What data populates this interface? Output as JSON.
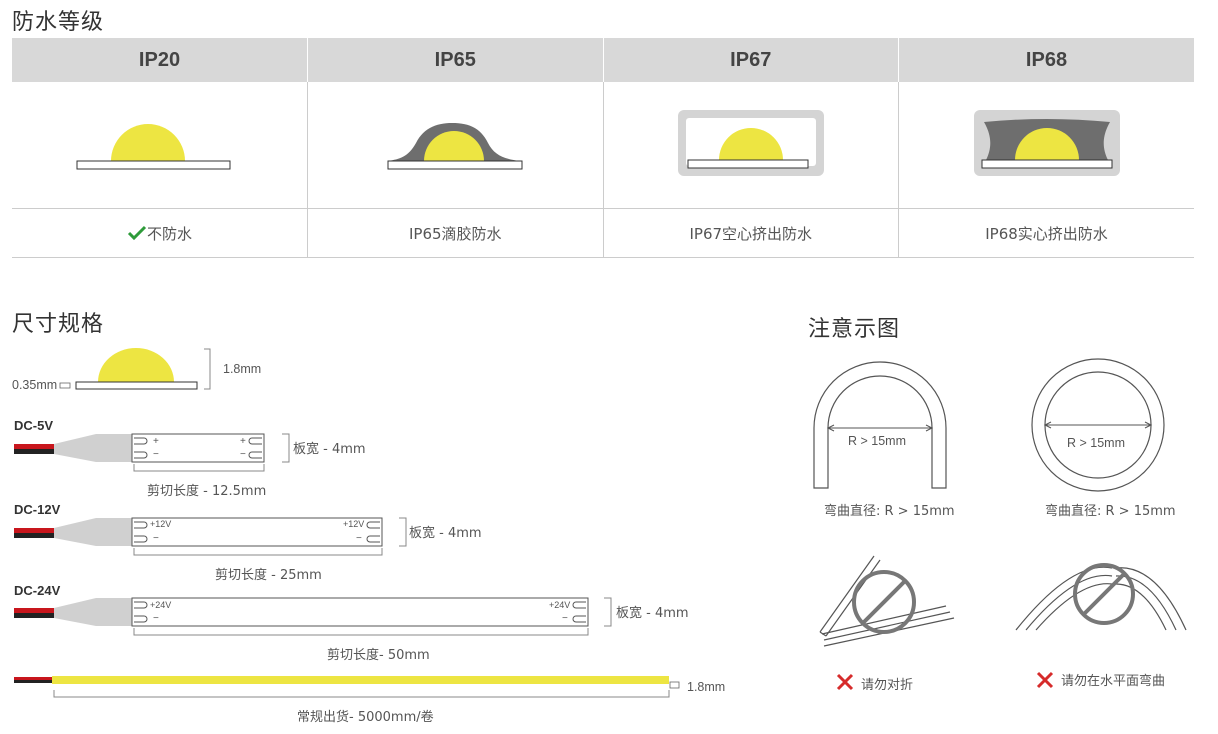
{
  "sections": {
    "waterproof_title": "防水等级",
    "size_title": "尺寸规格",
    "notes_title": "注意示图"
  },
  "ip_table": {
    "headers": [
      "IP20",
      "IP65",
      "IP67",
      "IP68"
    ],
    "labels": [
      "不防水",
      "IP65滴胶防水",
      "IP67空心挤出防水",
      "IP68实心挤出防水"
    ],
    "check_color": "#2e9b3a"
  },
  "size": {
    "thickness": "0.35mm",
    "height": "1.8mm",
    "variants": [
      {
        "voltage": "DC-5V",
        "pos_label": "+",
        "neg_label": "−",
        "width": "板宽 - 4mm",
        "cut": "剪切长度 - 12.5mm"
      },
      {
        "voltage": "DC-12V",
        "pos_label": "+12V",
        "neg_label": "−",
        "width": "板宽 - 4mm",
        "cut": "剪切长度 - 25mm"
      },
      {
        "voltage": "DC-24V",
        "pos_label": "+24V",
        "neg_label": "−",
        "width": "板宽 - 4mm",
        "cut": "剪切长度- 50mm"
      }
    ],
    "roll_height": "1.8mm",
    "roll_length": "常规出货- 5000mm/卷"
  },
  "notes": {
    "radius_label": "R > 15mm",
    "bend_caption_1": "弯曲直径: R > 15mm",
    "bend_caption_2": "弯曲直径: R > 15mm",
    "warn_1": "请勿对折",
    "warn_2": "请勿在水平面弯曲",
    "warn_color": "#d62b2b"
  },
  "colors": {
    "led_yellow": "#ede542",
    "gel_gray": "#6e6e6e",
    "housing_gray": "#d4d4d4",
    "wire_red": "#c8161d"
  }
}
